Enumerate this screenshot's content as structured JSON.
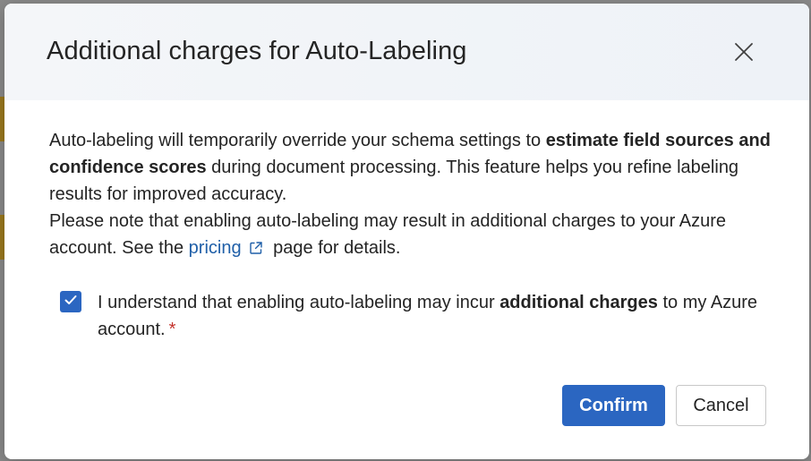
{
  "dialog": {
    "title": "Additional charges for Auto-Labeling",
    "close_icon": "close-icon",
    "paragraph1_part1": "Auto-labeling will temporarily override your schema settings to ",
    "paragraph1_bold": "estimate field sources and confidence scores",
    "paragraph1_part2": " during document processing. This feature helps you refine labeling results for improved accuracy.",
    "paragraph2_part1": "Please note that enabling auto-labeling may result in additional charges to your Azure account. See the ",
    "pricing_link": "pricing",
    "external_link_icon": "external-link-icon",
    "paragraph2_part2": " page for details.",
    "checkbox": {
      "checked": true,
      "label_part1": "I understand that enabling auto-labeling may incur ",
      "label_bold": "additional charges",
      "label_part2": " to my Azure account.",
      "required_mark": "*"
    },
    "confirm_label": "Confirm",
    "cancel_label": "Cancel"
  },
  "colors": {
    "accent": "#2b66c1",
    "link": "#1f5fa8",
    "required": "#c4312b",
    "text": "#242424"
  }
}
